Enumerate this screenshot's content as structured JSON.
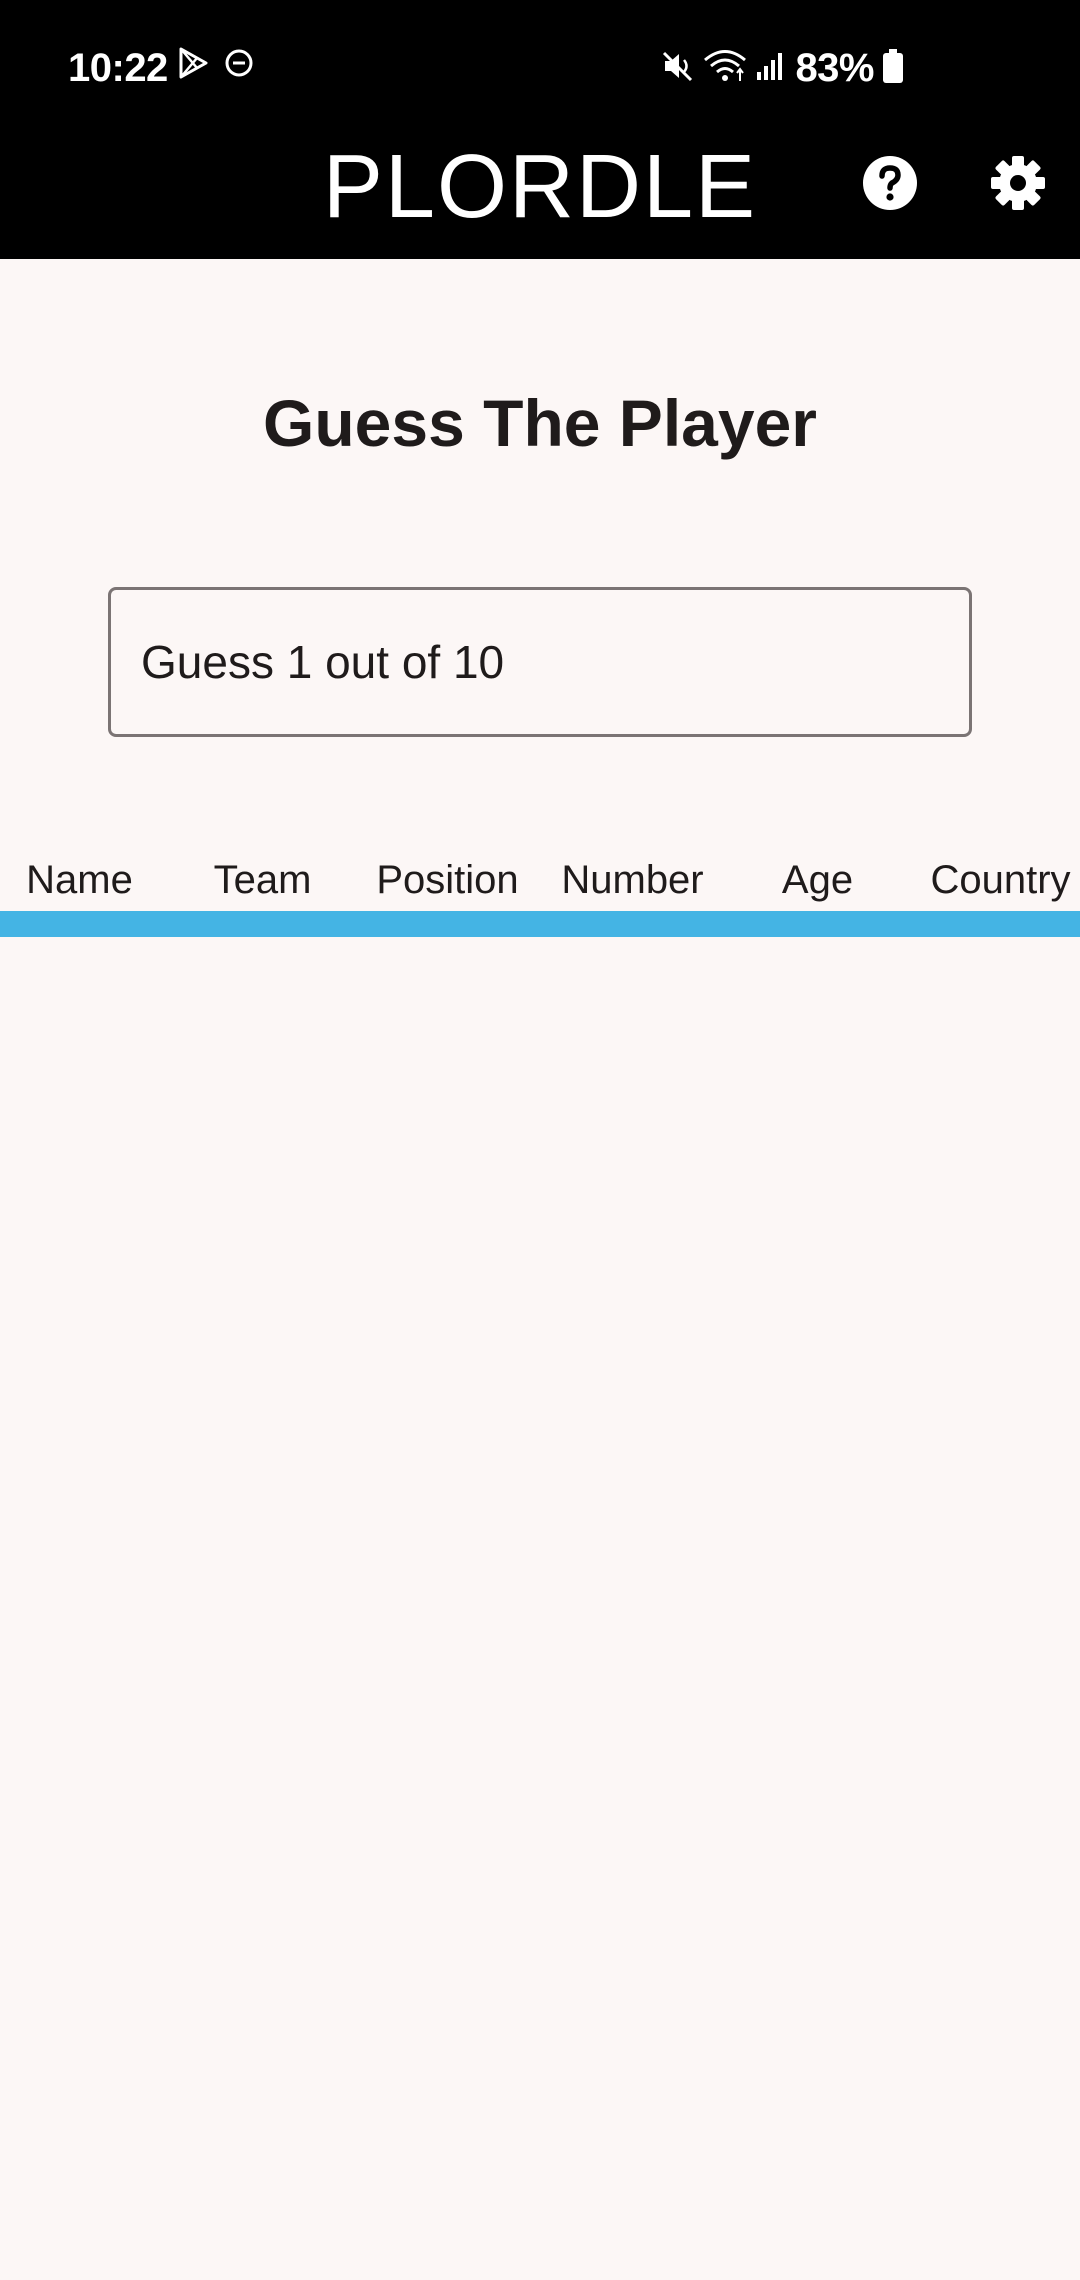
{
  "status_bar": {
    "time": "10:22",
    "battery": "83%",
    "icons_left": [
      "play-store-icon",
      "do-not-disturb-icon"
    ],
    "icons_right": [
      "mute-icon",
      "wifi-icon",
      "signal-icon",
      "battery-icon"
    ]
  },
  "app_bar": {
    "title": "PLORDLE",
    "help_icon": "help-icon",
    "settings_icon": "gear-icon"
  },
  "main": {
    "title": "Guess The Player",
    "guess_input": {
      "placeholder": "Guess 1 out of 10",
      "value": ""
    },
    "table": {
      "columns": [
        "Name",
        "Team",
        "Position",
        "Number",
        "Age",
        "Country"
      ]
    }
  },
  "colors": {
    "app_bar_background": "#000000",
    "page_background": "#fcf7f6",
    "divider": "#44b4e4",
    "text": "#1f1b1b"
  }
}
